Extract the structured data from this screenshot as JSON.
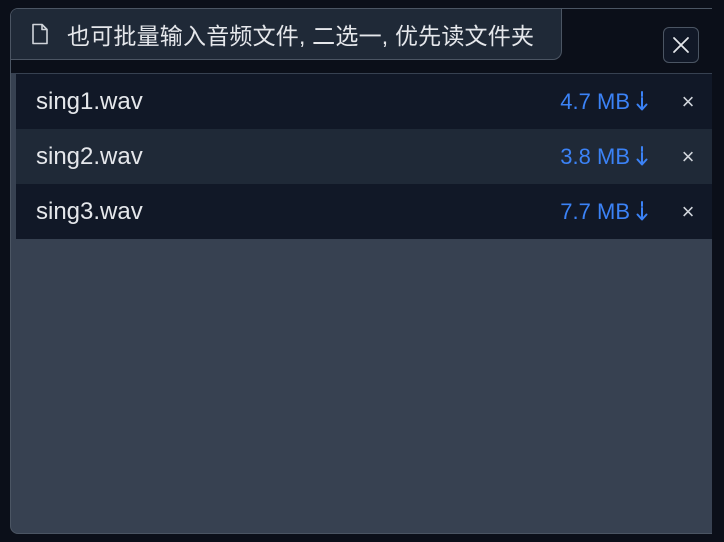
{
  "upload": {
    "label": "也可批量输入音频文件, 二选一, 优先读文件夹",
    "label_icon": "file-icon",
    "close_icon": "close-icon"
  },
  "files": [
    {
      "name": "sing1.wav",
      "size": "4.7 MB",
      "download_icon": "download-icon",
      "remove_label": "×"
    },
    {
      "name": "sing2.wav",
      "size": "3.8 MB",
      "download_icon": "download-icon",
      "remove_label": "×"
    },
    {
      "name": "sing3.wav",
      "size": "7.7 MB",
      "download_icon": "download-icon",
      "remove_label": "×"
    }
  ],
  "colors": {
    "panel_bg": "#374151",
    "row_dark": "#111827",
    "row_light": "#1f2937",
    "size_link": "#3b82f6",
    "text": "#e5e7eb"
  }
}
